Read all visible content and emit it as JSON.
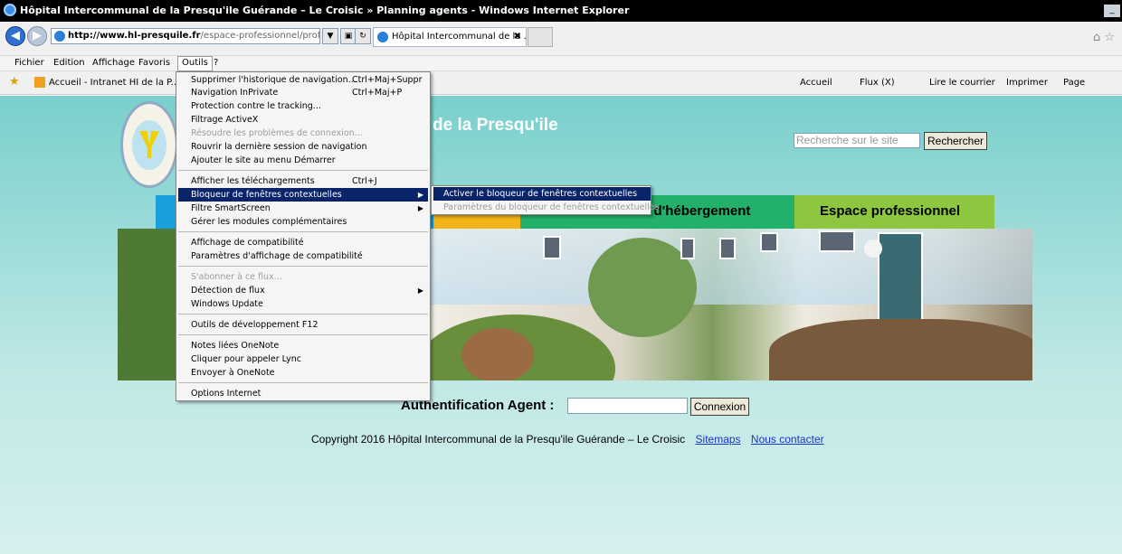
{
  "window": {
    "title": "Hôpital Intercommunal de la Presqu'ile Guérande – Le Croisic » Planning agents - Windows Internet Explorer"
  },
  "address": {
    "domain": "http://www.hl-presquile.fr",
    "path": "/espace-professionnel/professior"
  },
  "tab": {
    "label": "Hôpital Intercommunal de la ...",
    "close": "✖"
  },
  "menubar": {
    "items": [
      "Fichier",
      "Edition",
      "Affichage",
      "Favoris",
      "Outils",
      "?"
    ]
  },
  "favbar": {
    "fav_item": "Accueil - Intranet HI de la P...",
    "right": {
      "home": "Accueil",
      "feeds": "Flux (X)",
      "mail": "Lire le courrier",
      "print": "Imprimer",
      "page": "Page"
    }
  },
  "page": {
    "site_title": "de la Presqu'ile",
    "search_placeholder": "Recherche sur le site",
    "search_button": "Rechercher",
    "nav": {
      "green": "et d'hébergement",
      "lime": "Espace professionnel"
    },
    "auth_label": "Authentification Agent :",
    "auth_button": "Connexion",
    "footer_text": "Copyright 2016 Hôpital Intercommunal de la Presqu'ile Guérande – Le Croisic",
    "footer_links": [
      "Sitemaps",
      "Nous contacter"
    ]
  },
  "tools_menu": {
    "items": [
      {
        "label": "Supprimer l'historique de navigation...",
        "shortcut": "Ctrl+Maj+Suppr"
      },
      {
        "label": "Navigation InPrivate",
        "shortcut": "Ctrl+Maj+P"
      },
      {
        "label": "Protection contre le tracking..."
      },
      {
        "label": "Filtrage ActiveX"
      },
      {
        "label": "Résoudre les problèmes de connexion...",
        "disabled": true
      },
      {
        "label": "Rouvrir la dernière session de navigation"
      },
      {
        "label": "Ajouter le site au menu Démarrer"
      },
      {
        "label": "Afficher les téléchargements",
        "shortcut": "Ctrl+J"
      },
      {
        "label": "Bloqueur de fenêtres contextuelles",
        "highlighted": true
      },
      {
        "label": "Filtre SmartScreen"
      },
      {
        "label": "Gérer les modules complémentaires"
      },
      {
        "label": "Affichage de compatibilité"
      },
      {
        "label": "Paramètres d'affichage de compatibilité"
      },
      {
        "label": "S'abonner à ce flux...",
        "disabled": true
      },
      {
        "label": "Détection de flux"
      },
      {
        "label": "Windows Update"
      },
      {
        "label": "Outils de développement F12"
      },
      {
        "label": "Notes liées OneNote"
      },
      {
        "label": "Cliquer pour appeler Lync"
      },
      {
        "label": "Envoyer à OneNote"
      },
      {
        "label": "Options Internet"
      }
    ],
    "submenu": [
      {
        "label": "Activer le bloqueur de fenêtres contextuelles",
        "highlighted": true
      },
      {
        "label": "Paramètres du bloqueur de fenêtres contextuelles",
        "disabled": true
      }
    ]
  },
  "colors": {
    "highlight": "#0a246a",
    "nav_blue": "#1aa0dc",
    "nav_orange": "#f2b417",
    "nav_green": "#23b06a",
    "nav_lime": "#8dc63f"
  }
}
